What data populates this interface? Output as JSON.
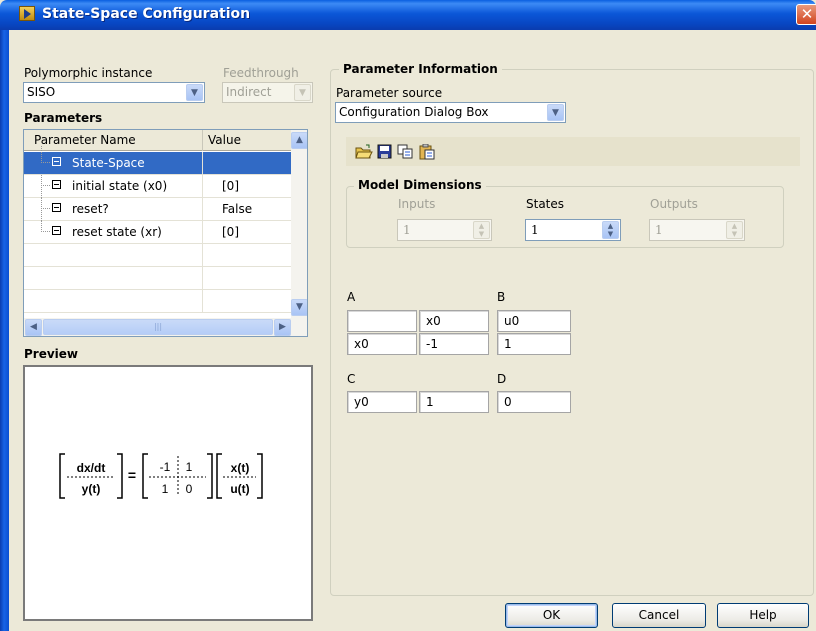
{
  "window": {
    "title": "State-Space Configuration"
  },
  "left": {
    "polymorphic_label": "Polymorphic instance",
    "polymorphic_value": "SISO",
    "feedthrough_label": "Feedthrough",
    "feedthrough_value": "Indirect",
    "parameters_label": "Parameters",
    "columns": [
      "Parameter Name",
      "Value"
    ],
    "rows": [
      {
        "name": "State-Space",
        "value": "",
        "selected": true
      },
      {
        "name": "initial state (x0)",
        "value": "[0]",
        "selected": false
      },
      {
        "name": "reset?",
        "value": "False",
        "selected": false
      },
      {
        "name": "reset state (xr)",
        "value": "[0]",
        "selected": false
      }
    ],
    "preview_label": "Preview",
    "preview": {
      "lhs": [
        "dx/dt",
        "y(t)"
      ],
      "matrix": [
        [
          "-1",
          "1"
        ],
        [
          "1",
          "0"
        ]
      ],
      "rhs": [
        "x(t)",
        "u(t)"
      ],
      "equals": "="
    }
  },
  "right": {
    "group_title": "Parameter Information",
    "source_label": "Parameter source",
    "source_value": "Configuration Dialog Box",
    "toolbar_icons": [
      "open-folder-icon",
      "save-icon",
      "copy-icon",
      "paste-icon"
    ],
    "model_dims": {
      "title": "Model Dimensions",
      "inputs_label": "Inputs",
      "inputs_value": "1",
      "inputs_enabled": false,
      "states_label": "States",
      "states_value": "1",
      "states_enabled": true,
      "outputs_label": "Outputs",
      "outputs_value": "1",
      "outputs_enabled": false
    },
    "matrices": {
      "A": {
        "label": "A",
        "col_header": "x0",
        "row_header": "x0",
        "value": "-1"
      },
      "B": {
        "label": "B",
        "col_header": "u0",
        "value": "1"
      },
      "C": {
        "label": "C",
        "row_header": "y0",
        "value": "1"
      },
      "D": {
        "label": "D",
        "value": "0"
      }
    }
  },
  "buttons": {
    "ok": "OK",
    "cancel": "Cancel",
    "help": "Help"
  },
  "colors": {
    "title_bar": "#0b57d8",
    "selection": "#316ac5",
    "dialog_bg": "#ece9d8",
    "close": "#d2441f"
  }
}
